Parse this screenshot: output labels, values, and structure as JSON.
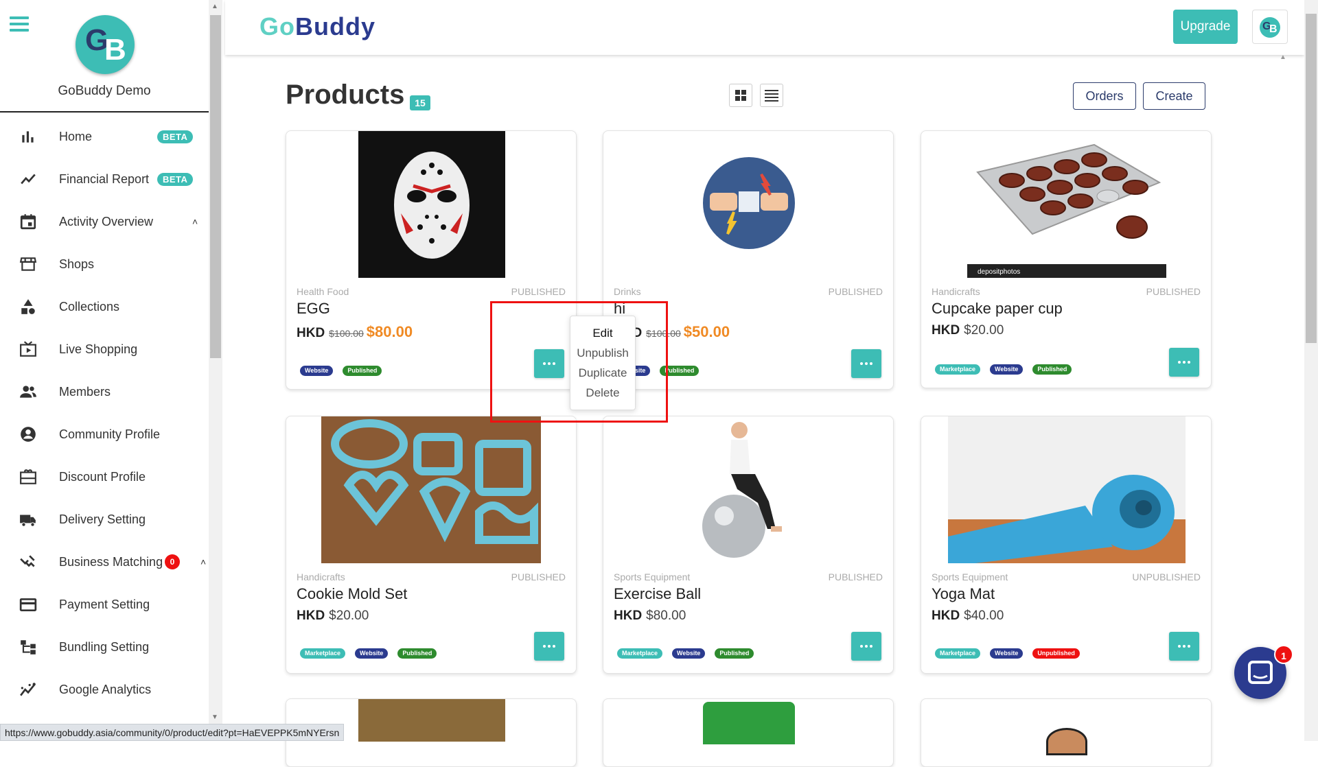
{
  "sidebar": {
    "org_name": "GoBuddy Demo",
    "logo_letters": [
      "G",
      "B"
    ],
    "items": [
      {
        "label": "Home",
        "icon": "bar-chart-icon",
        "badge": "BETA"
      },
      {
        "label": "Financial Report",
        "icon": "trending-icon",
        "badge": "BETA"
      },
      {
        "label": "Activity Overview",
        "icon": "calendar-icon",
        "chevron": "up"
      },
      {
        "label": "Shops",
        "icon": "store-icon"
      },
      {
        "label": "Collections",
        "icon": "shapes-icon"
      },
      {
        "label": "Live Shopping",
        "icon": "live-tv-icon"
      },
      {
        "label": "Members",
        "icon": "people-icon"
      },
      {
        "label": "Community Profile",
        "icon": "account-circle-icon"
      },
      {
        "label": "Discount Profile",
        "icon": "gift-card-icon"
      },
      {
        "label": "Delivery Setting",
        "icon": "truck-icon"
      },
      {
        "label": "Business Matching",
        "icon": "handshake-icon",
        "count": "0"
      },
      {
        "label": "Payment Setting",
        "icon": "credit-card-icon"
      },
      {
        "label": "Bundling Setting",
        "icon": "hierarchy-icon"
      },
      {
        "label": "Google Analytics",
        "icon": "analytics-icon"
      }
    ]
  },
  "header": {
    "brand_go": "Go",
    "brand_buddy": "Buddy",
    "upgrade_label": "Upgrade",
    "avatar_letters": [
      "G",
      "B"
    ]
  },
  "page": {
    "title": "Products",
    "count": "15",
    "orders_label": "Orders",
    "create_label": "Create"
  },
  "products": [
    {
      "category": "Health Food",
      "status": "PUBLISHED",
      "name": "EGG",
      "currency": "HKD",
      "old_price": "$100.00",
      "price": "$80.00",
      "tags": [
        "Website",
        "Published"
      ]
    },
    {
      "category": "Drinks",
      "status": "PUBLISHED",
      "name": "hi",
      "currency": "HKD",
      "old_price": "$100.00",
      "price": "$50.00",
      "tags": [
        "Website",
        "Published"
      ]
    },
    {
      "category": "Handicrafts",
      "status": "PUBLISHED",
      "name": "Cupcake paper cup",
      "currency": "HKD",
      "price": "$20.00",
      "tags": [
        "Marketplace",
        "Website",
        "Published"
      ]
    },
    {
      "category": "Handicrafts",
      "status": "PUBLISHED",
      "name": "Cookie Mold Set",
      "currency": "HKD",
      "price": "$20.00",
      "tags": [
        "Marketplace",
        "Website",
        "Published"
      ]
    },
    {
      "category": "Sports Equipment",
      "status": "PUBLISHED",
      "name": "Exercise Ball",
      "currency": "HKD",
      "price": "$80.00",
      "tags": [
        "Marketplace",
        "Website",
        "Published"
      ]
    },
    {
      "category": "Sports Equipment",
      "status": "UNPUBLISHED",
      "name": "Yoga Mat",
      "currency": "HKD",
      "price": "$40.00",
      "tags": [
        "Marketplace",
        "Website",
        "Unpublished"
      ]
    }
  ],
  "context_menu": {
    "items": [
      "Edit",
      "Unpublish",
      "Duplicate",
      "Delete"
    ]
  },
  "image_text": {
    "watermark": "depositphotos"
  },
  "statusbar": {
    "url": "https://www.gobuddy.asia/community/0/product/edit?pt=HaEVEPPK5mNYErsn"
  },
  "chat": {
    "unread": "1"
  },
  "colors": {
    "accent": "#3dbdb5",
    "brand_dark": "#2b3b8f",
    "sale": "#f08a24",
    "published": "#2e8b2e",
    "unpublished": "#ee1111"
  }
}
